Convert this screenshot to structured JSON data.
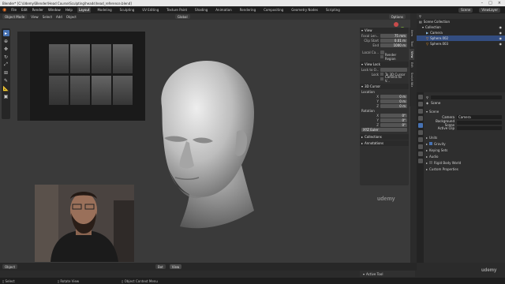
{
  "window": {
    "title": "Blender* [C:\\Udemy\\Blender\\Head Course\\Sculpting\\heads\\head_reference.blend]"
  },
  "menus": [
    "File",
    "Edit",
    "Render",
    "Window",
    "Help"
  ],
  "workspaces": [
    {
      "label": "Layout",
      "active": true
    },
    {
      "label": "Modeling",
      "active": false
    },
    {
      "label": "Sculpting",
      "active": false
    },
    {
      "label": "UV Editing",
      "active": false
    },
    {
      "label": "Texture Paint",
      "active": false
    },
    {
      "label": "Shading",
      "active": false
    },
    {
      "label": "Animation",
      "active": false
    },
    {
      "label": "Rendering",
      "active": false
    },
    {
      "label": "Compositing",
      "active": false
    },
    {
      "label": "Geometry Nodes",
      "active": false
    },
    {
      "label": "Scripting",
      "active": false
    }
  ],
  "scene_selector": "Scene",
  "view_layer_selector": "ViewLayer",
  "viewport_header": {
    "mode": "Object Mode",
    "menus": [
      "View",
      "Select",
      "Add",
      "Object"
    ],
    "transform": "Global",
    "options": "Options"
  },
  "npanel": {
    "sections": {
      "view_title": "View",
      "focal_label": "Focal Len...",
      "focal_value": "75 mm",
      "clip_start_label": "Clip Start",
      "clip_start_value": "0.01 m",
      "clip_end_label": "End",
      "clip_end_value": "1000 m",
      "local_camera_label": "Local Ca...",
      "render_region_label": "Render Region",
      "view_lock_title": "View Lock",
      "lock_to_obj_label": "Lock to O...",
      "lock_label": "Lock",
      "lock_3d_cursor": "To 3D Cursor",
      "camera_to_view": "Camera to V...",
      "cursor_title": "3D Cursor",
      "location_label": "Location",
      "loc_x": "0 m",
      "loc_y": "0 m",
      "loc_z": "0 m",
      "rotation_label": "Rotation",
      "rot_x": "0°",
      "rot_y": "0°",
      "rot_z": "0°",
      "rotation_mode": "XYZ Euler",
      "collections_title": "Collections",
      "annotations_title": "Annotations"
    },
    "tabs": [
      "Item",
      "Tool",
      "View",
      "Edit",
      "Sculpt Wiz"
    ]
  },
  "outliner": {
    "root": "Scene Collection",
    "rows": [
      {
        "label": "Collection",
        "indent": 1
      },
      {
        "label": "Camera",
        "indent": 2
      },
      {
        "label": "Sphere.002",
        "indent": 2
      },
      {
        "label": "Sphere.003",
        "indent": 2
      }
    ]
  },
  "properties": {
    "breadcrumb": "Scene",
    "scene_title": "Scene",
    "camera_label": "Camera",
    "camera_value": "Camera",
    "background_label": "Background Scene",
    "active_clip_label": "Active Clip",
    "sections": [
      "Units",
      "Gravity",
      "Keying Sets",
      "Audio",
      "Rigid Body World",
      "Custom Properties"
    ],
    "gravity_checked": true
  },
  "timeline": {
    "items": [
      "Object",
      "Bot",
      "View"
    ],
    "active_tool": "Active Tool"
  },
  "statusbar": {
    "items": [
      "Select",
      "Rotate View",
      "Object Context Menu"
    ]
  },
  "watermark": "udemy",
  "colors": {
    "accent": "#4772b3",
    "active_object": "#ffa52f",
    "viewport_bg": "#3a3a3a"
  }
}
